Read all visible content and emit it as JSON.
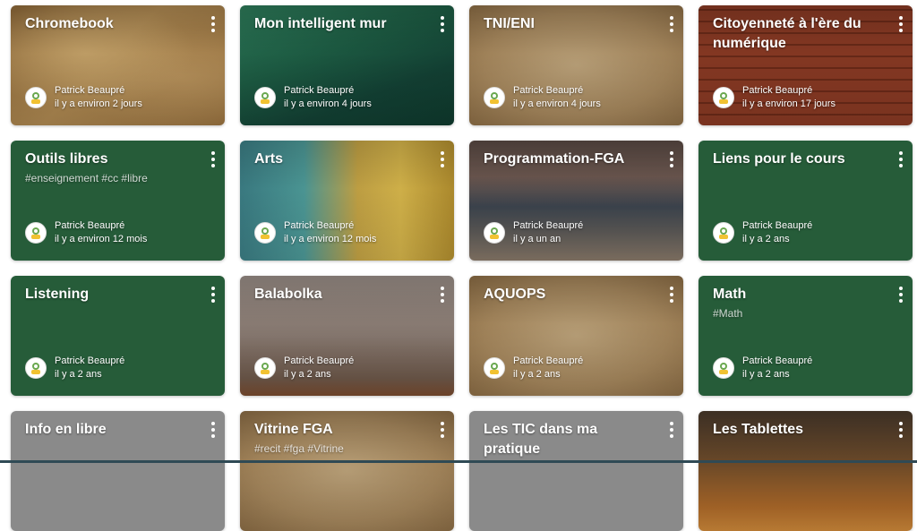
{
  "author": "Patrick Beaupré",
  "cards": [
    {
      "title": "Chromebook",
      "tags": "",
      "time": "il y a environ 2 jours",
      "bg": "bg-map"
    },
    {
      "title": "Mon intelligent mur",
      "tags": "",
      "time": "il y a environ 4 jours",
      "bg": "bg-poly"
    },
    {
      "title": "TNI/ENI",
      "tags": "",
      "time": "il y a environ 4 jours",
      "bg": "bg-parch"
    },
    {
      "title": "Citoyenneté à l'ère du numérique",
      "tags": "",
      "time": "il y a environ 17 jours",
      "bg": "bg-brick"
    },
    {
      "title": "Outils libres",
      "tags": "#enseignement #cc #libre",
      "time": "il y a environ 12 mois",
      "bg": "bg-green"
    },
    {
      "title": "Arts",
      "tags": "",
      "time": "il y a environ 12 mois",
      "bg": "bg-arts"
    },
    {
      "title": "Programmation-FGA",
      "tags": "",
      "time": "il y a un an",
      "bg": "bg-sea"
    },
    {
      "title": "Liens pour le cours",
      "tags": "",
      "time": "il y a 2 ans",
      "bg": "bg-green"
    },
    {
      "title": "Listening",
      "tags": "",
      "time": "il y a 2 ans",
      "bg": "bg-green"
    },
    {
      "title": "Balabolka",
      "tags": "",
      "time": "il y a 2 ans",
      "bg": "bg-fog"
    },
    {
      "title": "AQUOPS",
      "tags": "",
      "time": "il y a 2 ans",
      "bg": "bg-parch"
    },
    {
      "title": "Math",
      "tags": "#Math",
      "time": "il y a 2 ans",
      "bg": "bg-green"
    },
    {
      "title": "Info en libre",
      "tags": "",
      "time": "",
      "bg": "bg-grey"
    },
    {
      "title": "Vitrine FGA",
      "tags": "#recit #fga #Vitrine",
      "time": "",
      "bg": "bg-parch"
    },
    {
      "title": "Les TIC dans ma pratique",
      "tags": "",
      "time": "",
      "bg": "bg-grey"
    },
    {
      "title": "Les Tablettes",
      "tags": "",
      "time": "",
      "bg": "bg-fire"
    }
  ],
  "icons": {
    "menu": "more-vert-icon",
    "avatar": "avatar-icon"
  }
}
